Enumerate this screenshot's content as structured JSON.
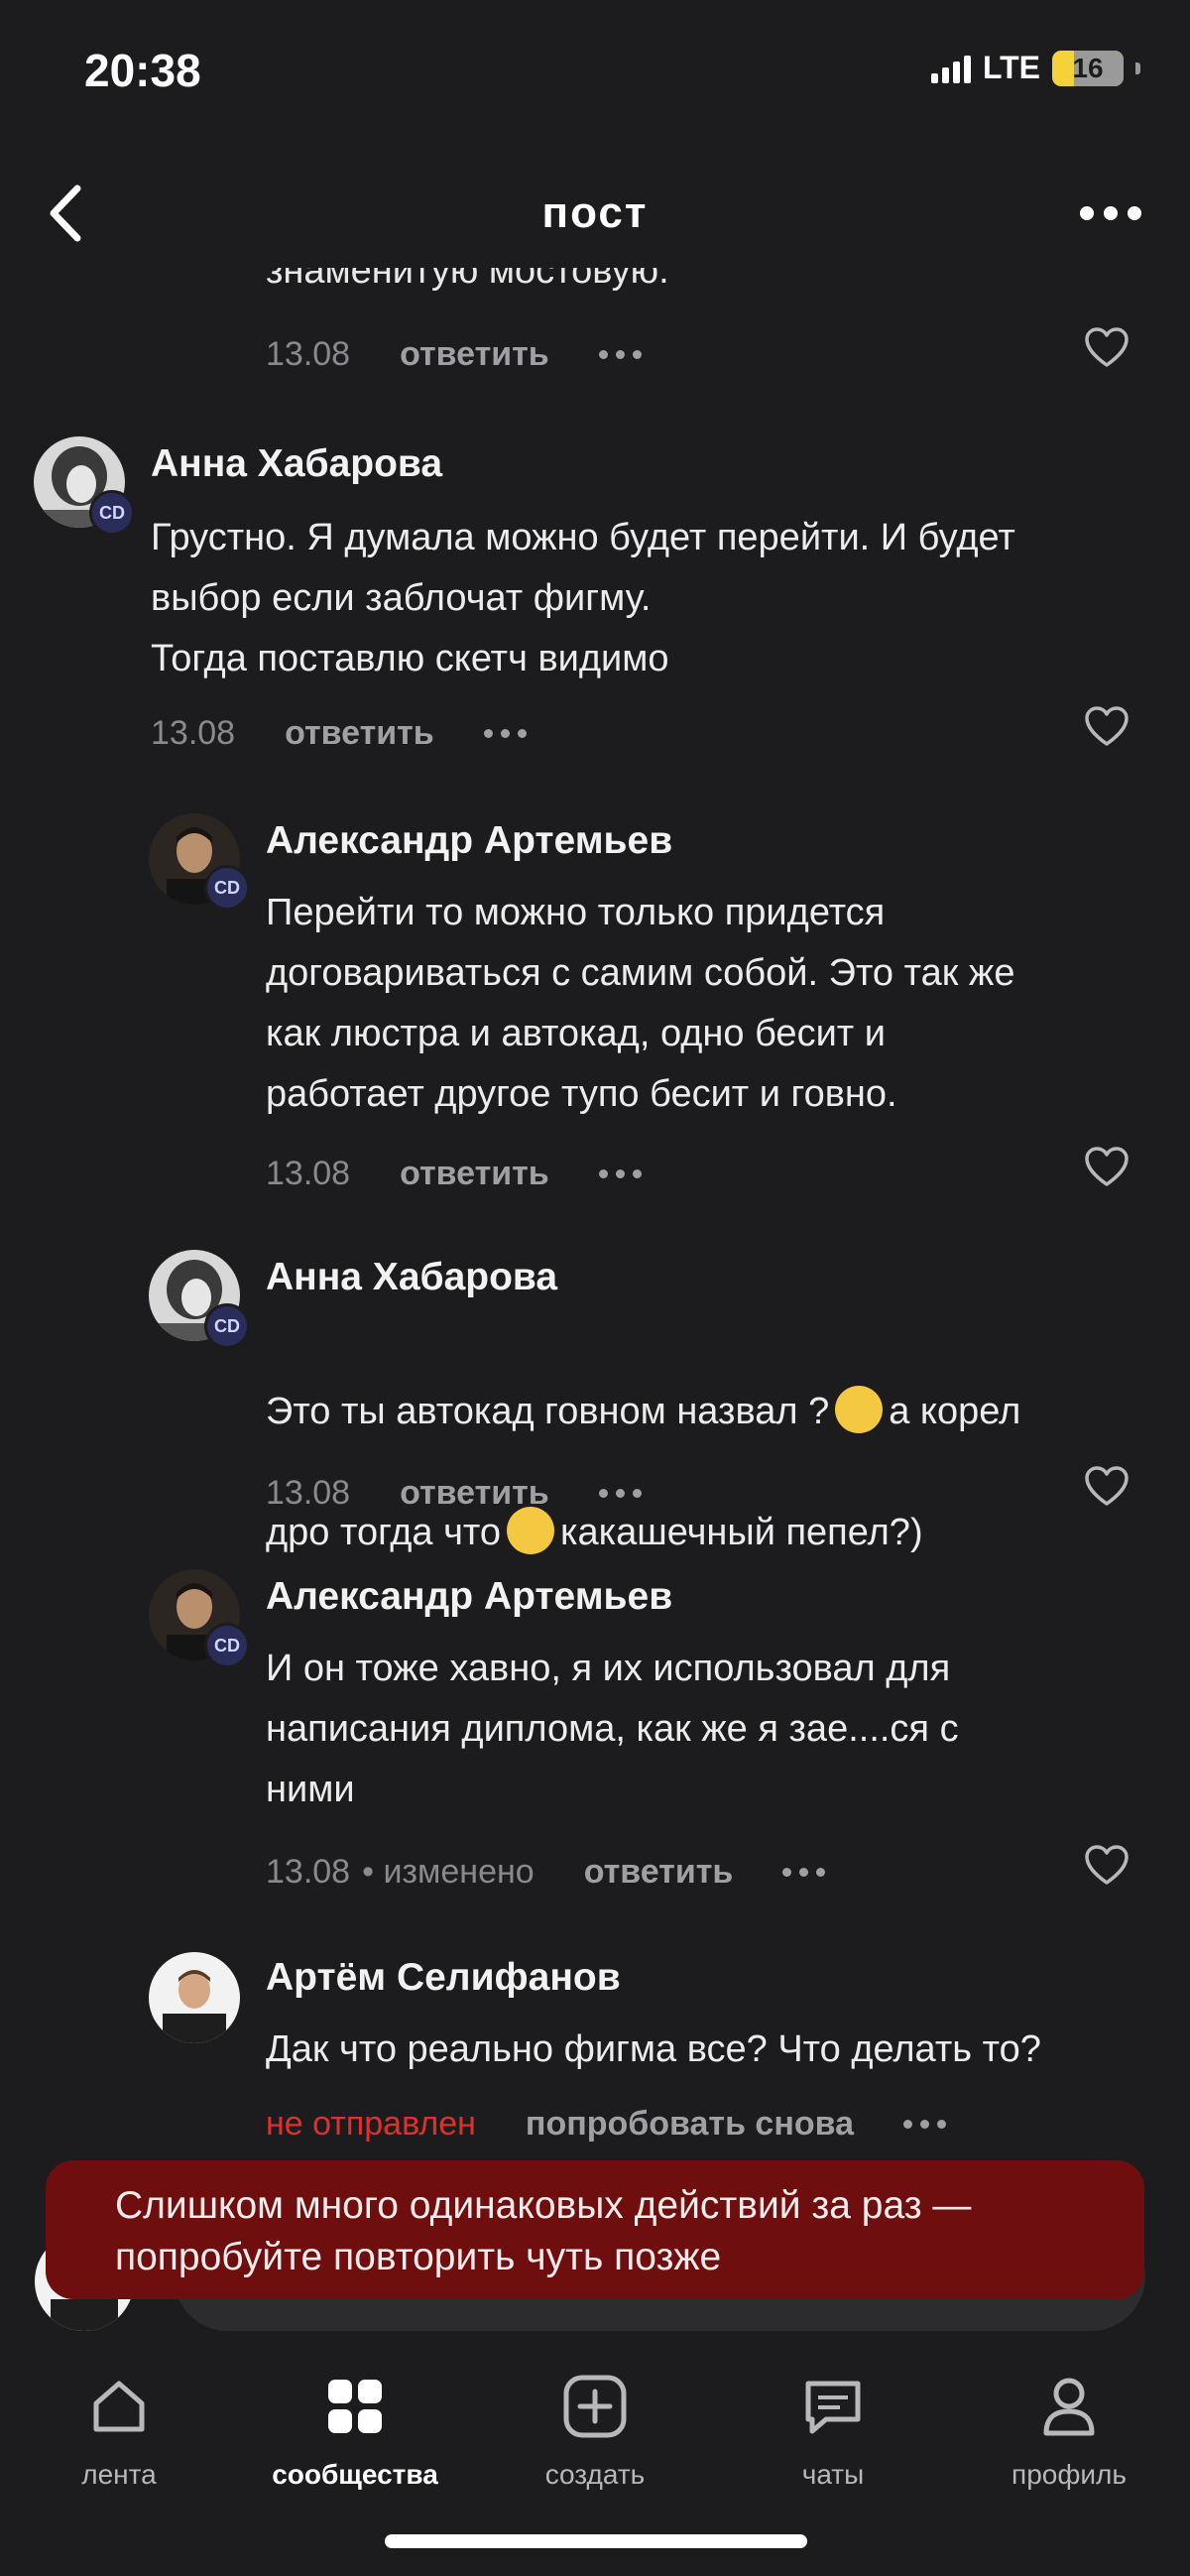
{
  "status_bar": {
    "time": "20:38",
    "network": "LTE",
    "battery": "16"
  },
  "header": {
    "title": "пост"
  },
  "partial_comment": {
    "text_fragment": "знаменитую мостовую.",
    "date": "13.08",
    "reply_label": "ответить"
  },
  "comments": [
    {
      "author": "Анна Хабарова",
      "text": "Грустно. Я думала можно будет перейти. И будет\nвыбор если заблочат фигму.\nТогда поставлю скетч видимо",
      "date": "13.08",
      "reply_label": "ответить",
      "badge": "CD"
    },
    {
      "author": "Александр Артемьев",
      "text": "Перейти то можно только придется\nдоговариваться с самим собой. Это так же\nкак люстра и автокад,  одно бесит  и\nработает другое тупо бесит и говно.",
      "date": "13.08",
      "reply_label": "ответить",
      "badge": "CD"
    },
    {
      "author": "Анна Хабарова",
      "text_part1": "Это ты автокад говном назвал ?",
      "text_part2": "а корел",
      "text_part3": "дро тогда что",
      "text_part4": "какашечный пепел?)",
      "date": "13.08",
      "reply_label": "ответить",
      "badge": "CD",
      "emoji1": "shocked-face-emoji",
      "emoji2": "sweat-smile-emoji"
    },
    {
      "author": "Александр Артемьев",
      "text": "И он тоже хавно, я их  использовал для\nнаписания диплома, как же я зае....ся с\nними",
      "date": "13.08",
      "edited": "• изменено",
      "reply_label": "ответить",
      "badge": "CD"
    },
    {
      "author": "Артём Селифанов",
      "text": "Дак что реально фигма все? Что делать то?",
      "error": "не отправлен",
      "retry_label": "попробовать снова"
    }
  ],
  "toast": {
    "message": "Слишком много одинаковых действий за раз —\nпопробуйте повторить чуть позже"
  },
  "tabs": [
    {
      "label": "лента",
      "icon": "home-icon",
      "active": false
    },
    {
      "label": "сообщества",
      "icon": "communities-icon",
      "active": true
    },
    {
      "label": "создать",
      "icon": "create-icon",
      "active": false
    },
    {
      "label": "чаты",
      "icon": "chat-icon",
      "active": false
    },
    {
      "label": "профиль",
      "icon": "profile-icon",
      "active": false
    }
  ],
  "colors": {
    "background": "#1c1c1e",
    "toast": "#6e0e0e",
    "error": "#e0302c",
    "badge": "#2a2d5a"
  }
}
